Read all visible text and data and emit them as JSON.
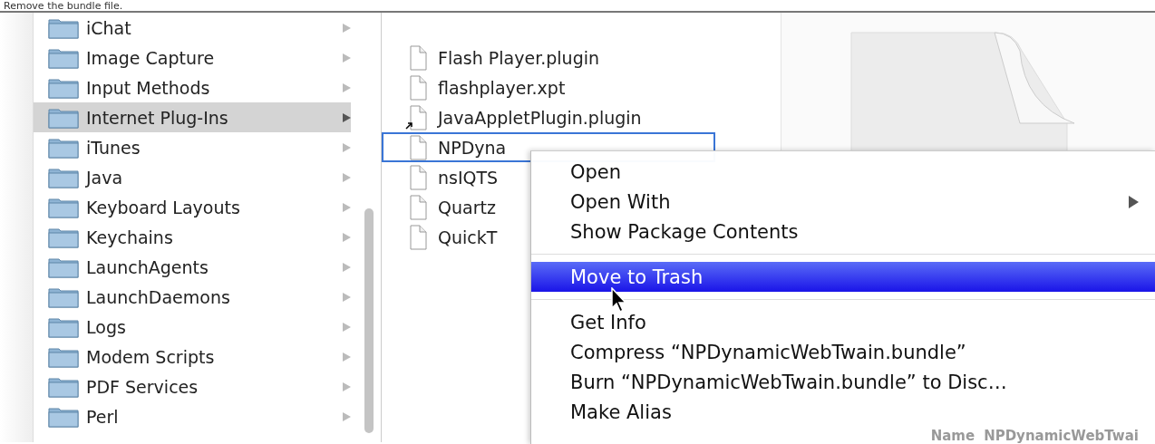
{
  "caption": "Remove the bundle file.",
  "folders": [
    {
      "name": "iChat",
      "selected": false
    },
    {
      "name": "Image Capture",
      "selected": false
    },
    {
      "name": "Input Methods",
      "selected": false
    },
    {
      "name": "Internet Plug-Ins",
      "selected": true
    },
    {
      "name": "iTunes",
      "selected": false
    },
    {
      "name": "Java",
      "selected": false
    },
    {
      "name": "Keyboard Layouts",
      "selected": false
    },
    {
      "name": "Keychains",
      "selected": false
    },
    {
      "name": "LaunchAgents",
      "selected": false
    },
    {
      "name": "LaunchDaemons",
      "selected": false
    },
    {
      "name": "Logs",
      "selected": false
    },
    {
      "name": "Modem Scripts",
      "selected": false
    },
    {
      "name": "PDF Services",
      "selected": false
    },
    {
      "name": "Perl",
      "selected": false
    }
  ],
  "files": [
    {
      "name": "Flash Player.plugin",
      "alias": false,
      "selected": false
    },
    {
      "name": "flashplayer.xpt",
      "alias": false,
      "selected": false
    },
    {
      "name": "JavaAppletPlugin.plugin",
      "alias": true,
      "selected": false
    },
    {
      "name": "NPDyna",
      "alias": false,
      "selected": true
    },
    {
      "name": "nsIQTS",
      "alias": false,
      "selected": false
    },
    {
      "name": "Quartz",
      "alias": false,
      "selected": false
    },
    {
      "name": "QuickT",
      "alias": false,
      "selected": false
    }
  ],
  "preview": {
    "name_label": "Name",
    "name_value": "NPDynamicWebTwai"
  },
  "context_menu": [
    {
      "kind": "item",
      "label": "Open",
      "submenu": false,
      "selected": false
    },
    {
      "kind": "item",
      "label": "Open With",
      "submenu": true,
      "selected": false
    },
    {
      "kind": "item",
      "label": "Show Package Contents",
      "submenu": false,
      "selected": false
    },
    {
      "kind": "separator"
    },
    {
      "kind": "item",
      "label": "Move to Trash",
      "submenu": false,
      "selected": true
    },
    {
      "kind": "separator"
    },
    {
      "kind": "item",
      "label": "Get Info",
      "submenu": false,
      "selected": false
    },
    {
      "kind": "item",
      "label": "Compress “NPDynamicWebTwain.bundle”",
      "submenu": false,
      "selected": false
    },
    {
      "kind": "item",
      "label": "Burn “NPDynamicWebTwain.bundle” to Disc…",
      "submenu": false,
      "selected": false
    },
    {
      "kind": "item",
      "label": "Make Alias",
      "submenu": false,
      "selected": false
    }
  ]
}
